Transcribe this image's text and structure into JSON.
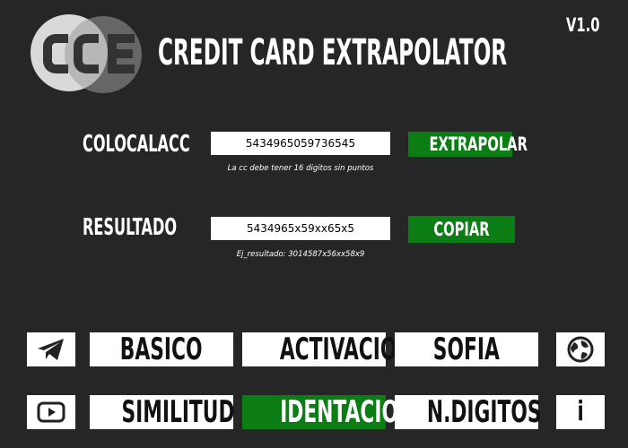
{
  "header": {
    "title": "CREDIT CARD EXTRAPOLATOR",
    "version": "V1.0",
    "logo_text": "CCE"
  },
  "input_row": {
    "label": "COLOCALACC",
    "value": "5434965059736545",
    "hint": "La cc debe tener 16 digitos sin puntos",
    "button_label": "EXTRAPOLAR"
  },
  "result_row": {
    "label": "RESULTADO",
    "value": "5434965x59xx65x5",
    "hint": "Ej_resultado: 3014587x56xx58x9",
    "button_label": "COPIAR"
  },
  "menu": {
    "row1": [
      "BASICO",
      "ACTIVACION",
      "SOFIA"
    ],
    "row2": [
      "SIMILITUD",
      "IDENTACION",
      "N.DIGITOS"
    ],
    "active": "IDENTACION",
    "info_label": "i",
    "icons": [
      "telegram-icon",
      "globe-icon",
      "youtube-icon",
      "info-icon"
    ]
  },
  "colors": {
    "background": "#262626",
    "accent_green": "#0b7d14",
    "tile": "#ffffff"
  }
}
